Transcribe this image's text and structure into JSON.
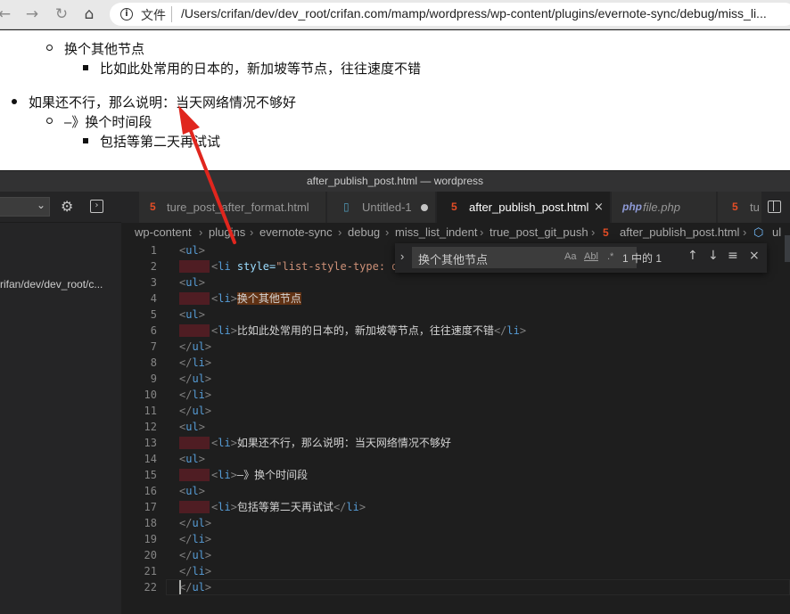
{
  "browser": {
    "file_label": "文件",
    "url": "/Users/crifan/dev/dev_root/crifan.com/mamp/wordpress/wp-content/plugins/evernote-sync/debug/miss_li..."
  },
  "webpage": {
    "item1": "换个其他节点",
    "item2": "比如此处常用的日本的，新加坡等节点，往往速度不错",
    "item3": "如果还不行，那么说明：当天网络情况不够好",
    "item4": "–》换个时间段",
    "item5": "包括等第二天再试试"
  },
  "vscode": {
    "window_title": "after_publish_post.html — wordpress",
    "sidebar_path": "rifan/dev/dev_root/c...",
    "tabs": [
      {
        "label": "ture_post_after_format.html"
      },
      {
        "label": "Untitled-1"
      },
      {
        "label": "after_publish_post.html"
      },
      {
        "label": "file.php"
      },
      {
        "label": "tu"
      }
    ],
    "breadcrumb": [
      "wp-content",
      "plugins",
      "evernote-sync",
      "debug",
      "miss_list_indent",
      "true_post_git_push",
      "after_publish_post.html",
      "ul"
    ],
    "find": {
      "query": "换个其他节点",
      "match_case": "Aa",
      "whole_word": "Abl",
      "regex": ".*",
      "count": "1 中的 1"
    },
    "lines": [
      {
        "n": "1",
        "pre": "<",
        "tag": "ul",
        "post": ">",
        "text": "",
        "end": ""
      },
      {
        "n": "2",
        "pre": "<",
        "tag": "li",
        "attr": " style=",
        "str": "\"list-style-type: d",
        "post": "",
        "text": "",
        "end": ""
      },
      {
        "n": "3",
        "pre": "<",
        "tag": "ul",
        "post": ">",
        "text": "",
        "end": ""
      },
      {
        "n": "4",
        "pre": "<",
        "tag": "li",
        "post": ">",
        "text": "换个其他节点",
        "end": ""
      },
      {
        "n": "5",
        "pre": "<",
        "tag": "ul",
        "post": ">",
        "text": "",
        "end": ""
      },
      {
        "n": "6",
        "pre": "<",
        "tag": "li",
        "post": ">",
        "text": "比如此处常用的日本的，新加坡等节点，往往速度不错",
        "end": "</li>"
      },
      {
        "n": "7",
        "pre": "</",
        "tag": "ul",
        "post": ">",
        "text": "",
        "end": ""
      },
      {
        "n": "8",
        "pre": "</",
        "tag": "li",
        "post": ">",
        "text": "",
        "end": ""
      },
      {
        "n": "9",
        "pre": "</",
        "tag": "ul",
        "post": ">",
        "text": "",
        "end": ""
      },
      {
        "n": "10",
        "pre": "</",
        "tag": "li",
        "post": ">",
        "text": "",
        "end": ""
      },
      {
        "n": "11",
        "pre": "</",
        "tag": "ul",
        "post": ">",
        "text": "",
        "end": ""
      },
      {
        "n": "12",
        "pre": "<",
        "tag": "ul",
        "post": ">",
        "text": "",
        "end": ""
      },
      {
        "n": "13",
        "pre": "<",
        "tag": "li",
        "post": ">",
        "text": "如果还不行，那么说明：当天网络情况不够好",
        "end": ""
      },
      {
        "n": "14",
        "pre": "<",
        "tag": "ul",
        "post": ">",
        "text": "",
        "end": ""
      },
      {
        "n": "15",
        "pre": "<",
        "tag": "li",
        "post": ">",
        "text": "–》换个时间段",
        "end": ""
      },
      {
        "n": "16",
        "pre": "<",
        "tag": "ul",
        "post": ">",
        "text": "",
        "end": ""
      },
      {
        "n": "17",
        "pre": "<",
        "tag": "li",
        "post": ">",
        "text": "包括等第二天再试试",
        "end": "</li>"
      },
      {
        "n": "18",
        "pre": "</",
        "tag": "ul",
        "post": ">",
        "text": "",
        "end": ""
      },
      {
        "n": "19",
        "pre": "</",
        "tag": "li",
        "post": ">",
        "text": "",
        "end": ""
      },
      {
        "n": "20",
        "pre": "</",
        "tag": "ul",
        "post": ">",
        "text": "",
        "end": ""
      },
      {
        "n": "21",
        "pre": "</",
        "tag": "li",
        "post": ">",
        "text": "",
        "end": ""
      },
      {
        "n": "22",
        "pre": "</",
        "tag": "ul",
        "post": ">",
        "text": "",
        "end": ""
      }
    ]
  },
  "colors": {
    "annotation_arrow": "#e0261e",
    "find_match_highlight": "#613214",
    "tag_name": "#569cd6"
  }
}
